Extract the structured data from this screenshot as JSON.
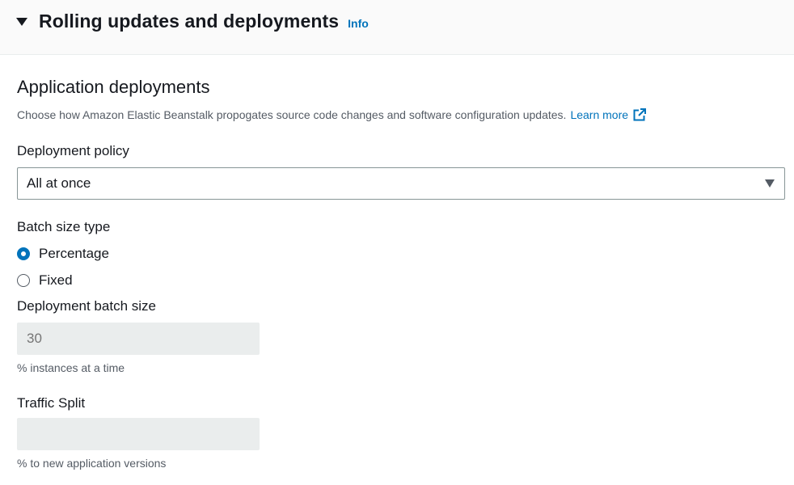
{
  "section": {
    "title": "Rolling updates and deployments",
    "info_link": "Info"
  },
  "application_deployments": {
    "heading": "Application deployments",
    "description": "Choose how Amazon Elastic Beanstalk propogates source code changes and software configuration updates.",
    "learn_more": "Learn more"
  },
  "deployment_policy": {
    "label": "Deployment policy",
    "selected": "All at once"
  },
  "batch_size_type": {
    "label": "Batch size type",
    "options": [
      {
        "label": "Percentage",
        "checked": true
      },
      {
        "label": "Fixed",
        "checked": false
      }
    ]
  },
  "deployment_batch_size": {
    "label": "Deployment batch size",
    "placeholder": "30",
    "hint": "% instances at a time"
  },
  "traffic_split": {
    "label": "Traffic Split",
    "placeholder": "",
    "hint": "% to new application versions"
  },
  "colors": {
    "link": "#0073bb",
    "text": "#16191f",
    "secondary_text": "#545b64",
    "disabled_bg": "#eaeded"
  },
  "icons": [
    "caret-down-icon",
    "external-link-icon",
    "select-caret-icon"
  ]
}
